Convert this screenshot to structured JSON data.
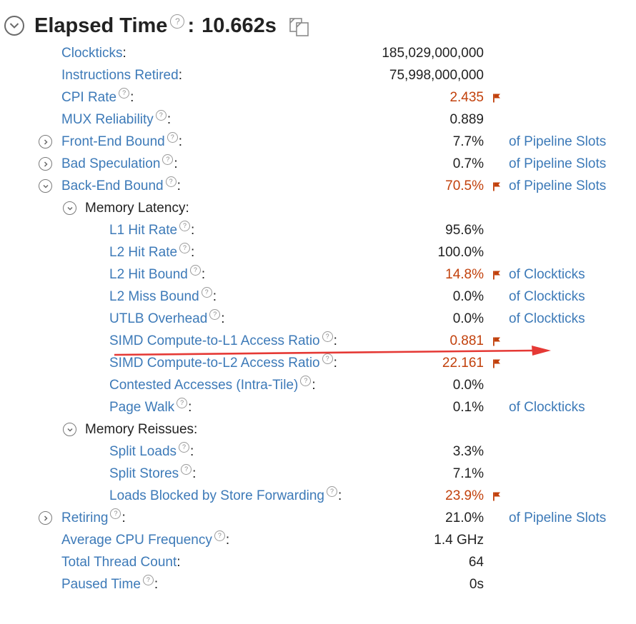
{
  "header": {
    "title": "Elapsed Time",
    "help": "?",
    "colon": ":",
    "value": "10.662s"
  },
  "metrics": [
    {
      "id": "clockticks",
      "label": "Clockticks",
      "help": false,
      "value": "185,029,000,000",
      "flag": false,
      "unit": "",
      "link": true,
      "toggle": "",
      "indent": 1
    },
    {
      "id": "instructions-retired",
      "label": "Instructions Retired",
      "help": false,
      "value": "75,998,000,000",
      "flag": false,
      "unit": "",
      "link": true,
      "toggle": "",
      "indent": 1
    },
    {
      "id": "cpi-rate",
      "label": "CPI Rate",
      "help": true,
      "value": "2.435",
      "flag": true,
      "unit": "",
      "link": true,
      "toggle": "",
      "indent": 1
    },
    {
      "id": "mux-reliability",
      "label": "MUX Reliability",
      "help": true,
      "value": "0.889",
      "flag": false,
      "unit": "",
      "link": true,
      "toggle": "",
      "indent": 1
    },
    {
      "id": "front-end-bound",
      "label": "Front-End Bound",
      "help": true,
      "value": "7.7%",
      "flag": false,
      "unit": "of Pipeline Slots",
      "link": true,
      "toggle": "right",
      "indent": 1
    },
    {
      "id": "bad-speculation",
      "label": "Bad Speculation",
      "help": true,
      "value": "0.7%",
      "flag": false,
      "unit": "of Pipeline Slots",
      "link": true,
      "toggle": "right",
      "indent": 1
    },
    {
      "id": "back-end-bound",
      "label": "Back-End Bound",
      "help": true,
      "value": "70.5%",
      "flag": true,
      "unit": "of Pipeline Slots",
      "link": true,
      "toggle": "down",
      "indent": 1
    },
    {
      "id": "memory-latency",
      "label": "Memory Latency",
      "help": false,
      "value": "",
      "flag": false,
      "unit": "",
      "link": false,
      "toggle": "down",
      "indent": 2
    },
    {
      "id": "l1-hit-rate",
      "label": "L1 Hit Rate",
      "help": true,
      "value": "95.6%",
      "flag": false,
      "unit": "",
      "link": true,
      "toggle": "",
      "indent": 3
    },
    {
      "id": "l2-hit-rate",
      "label": "L2 Hit Rate",
      "help": true,
      "value": "100.0%",
      "flag": false,
      "unit": "",
      "link": true,
      "toggle": "",
      "indent": 3
    },
    {
      "id": "l2-hit-bound",
      "label": "L2 Hit Bound",
      "help": true,
      "value": "14.8%",
      "flag": true,
      "unit": "of Clockticks",
      "link": true,
      "toggle": "",
      "indent": 3
    },
    {
      "id": "l2-miss-bound",
      "label": "L2 Miss Bound",
      "help": true,
      "value": "0.0%",
      "flag": false,
      "unit": "of Clockticks",
      "link": true,
      "toggle": "",
      "indent": 3
    },
    {
      "id": "utlb-overhead",
      "label": "UTLB Overhead",
      "help": true,
      "value": "0.0%",
      "flag": false,
      "unit": "of Clockticks",
      "link": true,
      "toggle": "",
      "indent": 3
    },
    {
      "id": "simd-l1",
      "label": "SIMD Compute-to-L1 Access Ratio",
      "help": true,
      "value": "0.881",
      "flag": true,
      "unit": "",
      "link": true,
      "toggle": "",
      "indent": 3
    },
    {
      "id": "simd-l2",
      "label": "SIMD Compute-to-L2 Access Ratio",
      "help": true,
      "value": "22.161",
      "flag": true,
      "unit": "",
      "link": true,
      "toggle": "",
      "indent": 3
    },
    {
      "id": "contested-accesses",
      "label": "Contested Accesses (Intra-Tile)",
      "help": true,
      "value": "0.0%",
      "flag": false,
      "unit": "",
      "link": true,
      "toggle": "",
      "indent": 3
    },
    {
      "id": "page-walk",
      "label": "Page Walk",
      "help": true,
      "value": "0.1%",
      "flag": false,
      "unit": "of Clockticks",
      "link": true,
      "toggle": "",
      "indent": 3
    },
    {
      "id": "memory-reissues",
      "label": "Memory Reissues",
      "help": false,
      "value": "",
      "flag": false,
      "unit": "",
      "link": false,
      "toggle": "down",
      "indent": 2
    },
    {
      "id": "split-loads",
      "label": "Split Loads",
      "help": true,
      "value": "3.3%",
      "flag": false,
      "unit": "",
      "link": true,
      "toggle": "",
      "indent": 3
    },
    {
      "id": "split-stores",
      "label": "Split Stores",
      "help": true,
      "value": "7.1%",
      "flag": false,
      "unit": "",
      "link": true,
      "toggle": "",
      "indent": 3
    },
    {
      "id": "loads-blocked",
      "label": "Loads Blocked by Store Forwarding",
      "help": true,
      "value": "23.9%",
      "flag": true,
      "unit": "",
      "link": true,
      "toggle": "",
      "indent": 3
    },
    {
      "id": "retiring",
      "label": "Retiring",
      "help": true,
      "value": "21.0%",
      "flag": false,
      "unit": "of Pipeline Slots",
      "link": true,
      "toggle": "right",
      "indent": 1
    },
    {
      "id": "avg-cpu-frequency",
      "label": "Average CPU Frequency",
      "help": true,
      "value": "1.4 GHz",
      "flag": false,
      "unit": "",
      "link": true,
      "toggle": "",
      "indent": 1
    },
    {
      "id": "total-thread-count",
      "label": "Total Thread Count",
      "help": false,
      "value": "64",
      "flag": false,
      "unit": "",
      "link": true,
      "toggle": "",
      "indent": 1
    },
    {
      "id": "paused-time",
      "label": "Paused Time",
      "help": true,
      "value": "0s",
      "flag": false,
      "unit": "",
      "link": true,
      "toggle": "",
      "indent": 1
    }
  ],
  "colors": {
    "link": "#3d7ab8",
    "flagged": "#c2410c",
    "annotation_arrow": "#e53935"
  },
  "icons": {
    "header_toggle": "chevron-down-icon",
    "copy": "copy-icon",
    "help": "help-icon",
    "flag": "flag-icon"
  }
}
